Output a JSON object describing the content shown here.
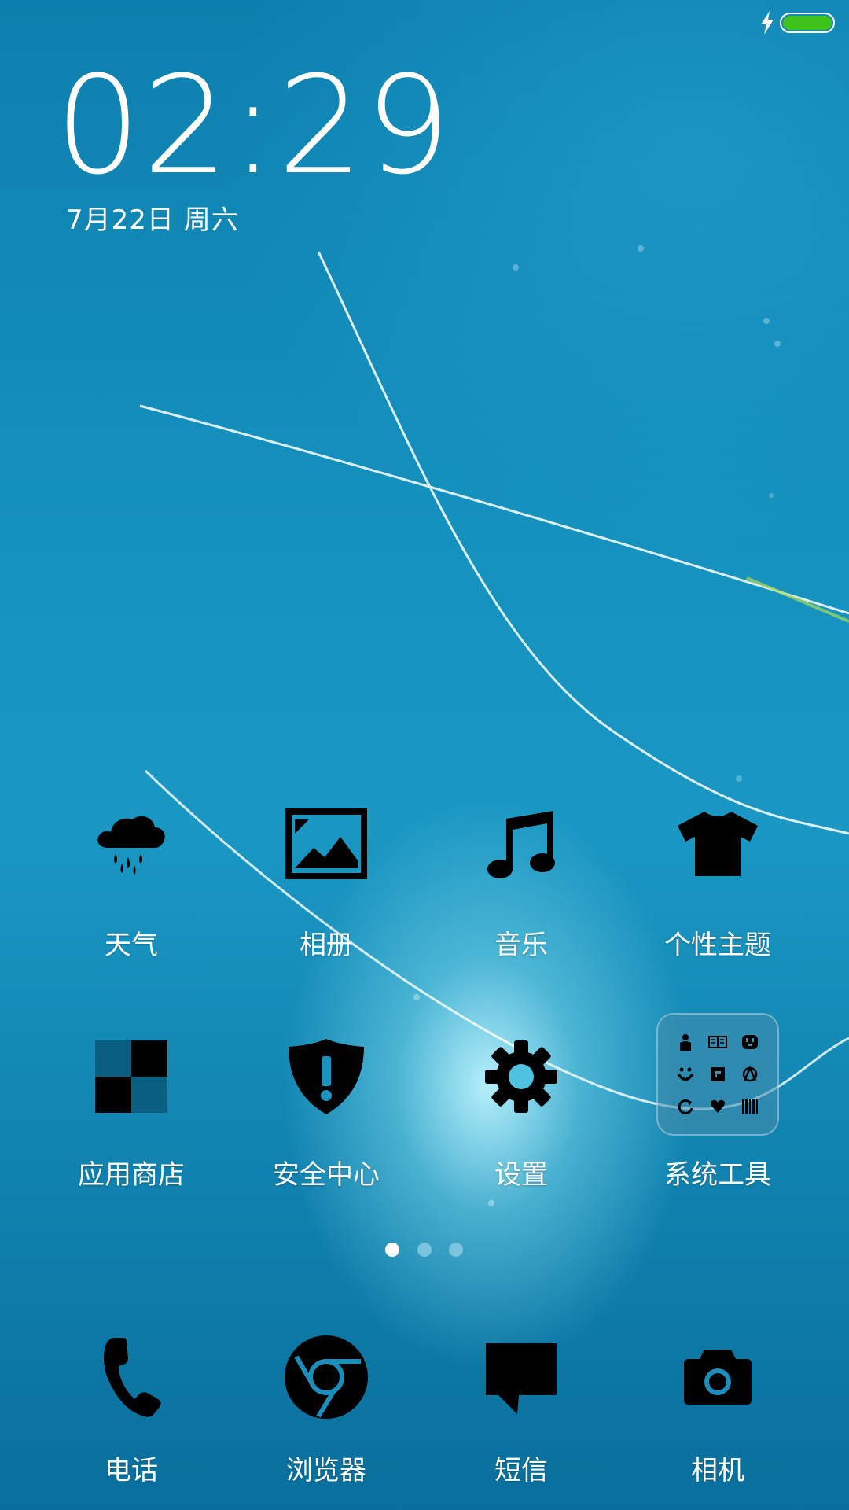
{
  "status_bar": {
    "charging_icon": "lightning-bolt-icon",
    "battery_icon": "battery-full-icon",
    "battery_color": "#3fc21a"
  },
  "clock": {
    "time": "02:29",
    "date": "7月22日 周六"
  },
  "apps": [
    {
      "id": "weather",
      "label": "天气",
      "icon": "cloud-rain-icon"
    },
    {
      "id": "gallery",
      "label": "相册",
      "icon": "picture-icon"
    },
    {
      "id": "music",
      "label": "音乐",
      "icon": "music-note-icon"
    },
    {
      "id": "themes",
      "label": "个性主题",
      "icon": "tshirt-icon"
    },
    {
      "id": "app-store",
      "label": "应用商店",
      "icon": "checker-grid-icon"
    },
    {
      "id": "security",
      "label": "安全中心",
      "icon": "shield-alert-icon"
    },
    {
      "id": "settings",
      "label": "设置",
      "icon": "gear-icon"
    },
    {
      "id": "system-tools",
      "label": "系统工具",
      "icon": "folder-icon"
    }
  ],
  "folder_items": [
    "person-icon",
    "book-icon",
    "power-plug-icon",
    "smile-icon",
    "square-arrow-icon",
    "compass-icon",
    "refresh-icon",
    "heart-icon",
    "barcode-icon"
  ],
  "page_indicator": {
    "pages": 3,
    "current": 1,
    "active_color": "#ffffff",
    "inactive_color": "#7cc3dd"
  },
  "dock": [
    {
      "id": "phone",
      "label": "电话",
      "icon": "phone-icon"
    },
    {
      "id": "browser",
      "label": "浏览器",
      "icon": "browser-icon"
    },
    {
      "id": "messages",
      "label": "短信",
      "icon": "message-icon"
    },
    {
      "id": "camera",
      "label": "相机",
      "icon": "camera-icon"
    }
  ]
}
